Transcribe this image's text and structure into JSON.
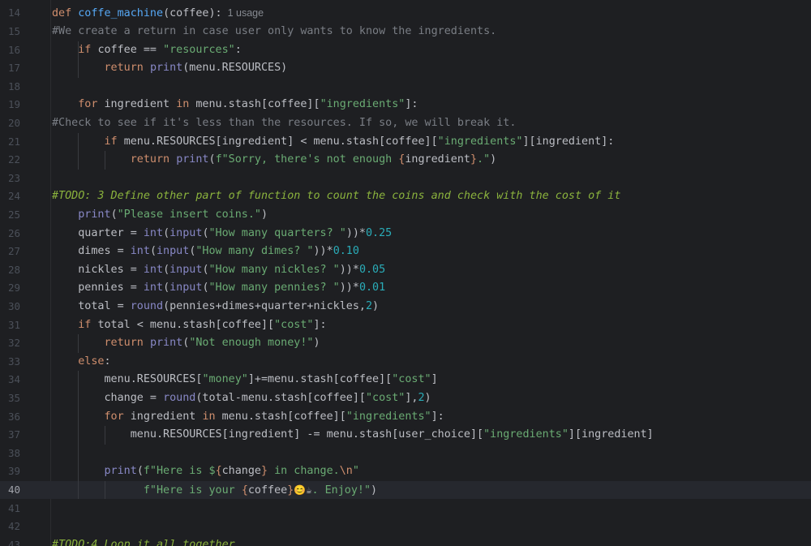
{
  "editor": {
    "current_line": "40",
    "usage_hint": "1 usage",
    "lines": [
      {
        "num": "14",
        "segs": [
          {
            "t": "def ",
            "c": "kw"
          },
          {
            "t": "coffe_machine",
            "c": "fn"
          },
          {
            "t": "(coffee):",
            "c": ""
          }
        ]
      },
      {
        "num": "15",
        "segs": [
          {
            "t": "#We create a return in case user only wants to know the ingredients.",
            "c": "cmt"
          }
        ]
      },
      {
        "num": "16",
        "segs": [
          {
            "t": "    ",
            "c": ""
          },
          {
            "t": "if ",
            "c": "kw"
          },
          {
            "t": "coffee == ",
            "c": ""
          },
          {
            "t": "\"resources\"",
            "c": "str"
          },
          {
            "t": ":",
            "c": ""
          }
        ]
      },
      {
        "num": "17",
        "segs": [
          {
            "t": "        ",
            "c": ""
          },
          {
            "t": "return ",
            "c": "kw"
          },
          {
            "t": "print",
            "c": "bi"
          },
          {
            "t": "(menu.RESOURCES)",
            "c": ""
          }
        ]
      },
      {
        "num": "18",
        "segs": []
      },
      {
        "num": "19",
        "segs": [
          {
            "t": "    ",
            "c": ""
          },
          {
            "t": "for ",
            "c": "kw"
          },
          {
            "t": "ingredient ",
            "c": ""
          },
          {
            "t": "in ",
            "c": "kw"
          },
          {
            "t": "menu.stash[coffee][",
            "c": ""
          },
          {
            "t": "\"ingredients\"",
            "c": "str"
          },
          {
            "t": "]:",
            "c": ""
          }
        ]
      },
      {
        "num": "20",
        "segs": [
          {
            "t": "#Check to see if it's less than the resources. If so, we will break it.",
            "c": "cmt"
          }
        ]
      },
      {
        "num": "21",
        "segs": [
          {
            "t": "        ",
            "c": ""
          },
          {
            "t": "if ",
            "c": "kw"
          },
          {
            "t": "menu.RESOURCES[ingredient] < menu.stash[coffee][",
            "c": ""
          },
          {
            "t": "\"ingredients\"",
            "c": "str"
          },
          {
            "t": "][ingredient]:",
            "c": ""
          }
        ]
      },
      {
        "num": "22",
        "segs": [
          {
            "t": "            ",
            "c": ""
          },
          {
            "t": "return ",
            "c": "kw"
          },
          {
            "t": "print",
            "c": "bi"
          },
          {
            "t": "(",
            "c": ""
          },
          {
            "t": "f\"Sorry, there's not enough ",
            "c": "str"
          },
          {
            "t": "{",
            "c": "brace"
          },
          {
            "t": "ingredient",
            "c": ""
          },
          {
            "t": "}",
            "c": "brace"
          },
          {
            "t": ".\"",
            "c": "str"
          },
          {
            "t": ")",
            "c": ""
          }
        ]
      },
      {
        "num": "23",
        "segs": []
      },
      {
        "num": "24",
        "segs": [
          {
            "t": "#TODO: 3 Define other part of function to count the coins and check with the cost of it",
            "c": "todo"
          }
        ]
      },
      {
        "num": "25",
        "segs": [
          {
            "t": "    ",
            "c": ""
          },
          {
            "t": "print",
            "c": "bi"
          },
          {
            "t": "(",
            "c": ""
          },
          {
            "t": "\"Please insert coins.\"",
            "c": "str"
          },
          {
            "t": ")",
            "c": ""
          }
        ]
      },
      {
        "num": "26",
        "segs": [
          {
            "t": "    quarter = ",
            "c": ""
          },
          {
            "t": "int",
            "c": "bi"
          },
          {
            "t": "(",
            "c": ""
          },
          {
            "t": "input",
            "c": "bi"
          },
          {
            "t": "(",
            "c": ""
          },
          {
            "t": "\"How many quarters? \"",
            "c": "str"
          },
          {
            "t": "))*",
            "c": ""
          },
          {
            "t": "0.25",
            "c": "num"
          }
        ]
      },
      {
        "num": "27",
        "segs": [
          {
            "t": "    dimes = ",
            "c": ""
          },
          {
            "t": "int",
            "c": "bi"
          },
          {
            "t": "(",
            "c": ""
          },
          {
            "t": "input",
            "c": "bi"
          },
          {
            "t": "(",
            "c": ""
          },
          {
            "t": "\"How many dimes? \"",
            "c": "str"
          },
          {
            "t": "))*",
            "c": ""
          },
          {
            "t": "0.10",
            "c": "num"
          }
        ]
      },
      {
        "num": "28",
        "segs": [
          {
            "t": "    nickles = ",
            "c": ""
          },
          {
            "t": "int",
            "c": "bi"
          },
          {
            "t": "(",
            "c": ""
          },
          {
            "t": "input",
            "c": "bi"
          },
          {
            "t": "(",
            "c": ""
          },
          {
            "t": "\"How many nickles? \"",
            "c": "str"
          },
          {
            "t": "))*",
            "c": ""
          },
          {
            "t": "0.05",
            "c": "num"
          }
        ]
      },
      {
        "num": "29",
        "segs": [
          {
            "t": "    pennies = ",
            "c": ""
          },
          {
            "t": "int",
            "c": "bi"
          },
          {
            "t": "(",
            "c": ""
          },
          {
            "t": "input",
            "c": "bi"
          },
          {
            "t": "(",
            "c": ""
          },
          {
            "t": "\"How many pennies? \"",
            "c": "str"
          },
          {
            "t": "))*",
            "c": ""
          },
          {
            "t": "0.01",
            "c": "num"
          }
        ]
      },
      {
        "num": "30",
        "segs": [
          {
            "t": "    total = ",
            "c": ""
          },
          {
            "t": "round",
            "c": "bi"
          },
          {
            "t": "(pennies+dimes+quarter+nickles,",
            "c": ""
          },
          {
            "t": "2",
            "c": "num"
          },
          {
            "t": ")",
            "c": ""
          }
        ]
      },
      {
        "num": "31",
        "segs": [
          {
            "t": "    ",
            "c": ""
          },
          {
            "t": "if ",
            "c": "kw"
          },
          {
            "t": "total < menu.stash[coffee][",
            "c": ""
          },
          {
            "t": "\"cost\"",
            "c": "str"
          },
          {
            "t": "]:",
            "c": ""
          }
        ]
      },
      {
        "num": "32",
        "segs": [
          {
            "t": "        ",
            "c": ""
          },
          {
            "t": "return ",
            "c": "kw"
          },
          {
            "t": "print",
            "c": "bi"
          },
          {
            "t": "(",
            "c": ""
          },
          {
            "t": "\"Not enough money!\"",
            "c": "str"
          },
          {
            "t": ")",
            "c": ""
          }
        ]
      },
      {
        "num": "33",
        "segs": [
          {
            "t": "    ",
            "c": ""
          },
          {
            "t": "else",
            "c": "kw"
          },
          {
            "t": ":",
            "c": ""
          }
        ]
      },
      {
        "num": "34",
        "segs": [
          {
            "t": "        menu.RESOURCES[",
            "c": ""
          },
          {
            "t": "\"money\"",
            "c": "str"
          },
          {
            "t": "]+=menu.stash[coffee][",
            "c": ""
          },
          {
            "t": "\"cost\"",
            "c": "str"
          },
          {
            "t": "]",
            "c": ""
          }
        ]
      },
      {
        "num": "35",
        "segs": [
          {
            "t": "        change = ",
            "c": ""
          },
          {
            "t": "round",
            "c": "bi"
          },
          {
            "t": "(total-menu.stash[coffee][",
            "c": ""
          },
          {
            "t": "\"cost\"",
            "c": "str"
          },
          {
            "t": "],",
            "c": ""
          },
          {
            "t": "2",
            "c": "num"
          },
          {
            "t": ")",
            "c": ""
          }
        ]
      },
      {
        "num": "36",
        "segs": [
          {
            "t": "        ",
            "c": ""
          },
          {
            "t": "for ",
            "c": "kw"
          },
          {
            "t": "ingredient ",
            "c": ""
          },
          {
            "t": "in ",
            "c": "kw"
          },
          {
            "t": "menu.stash[coffee][",
            "c": ""
          },
          {
            "t": "\"ingredients\"",
            "c": "str"
          },
          {
            "t": "]:",
            "c": ""
          }
        ]
      },
      {
        "num": "37",
        "segs": [
          {
            "t": "            menu.RESOURCES[ingredient] -= menu.stash[user_choice][",
            "c": ""
          },
          {
            "t": "\"ingredients\"",
            "c": "str"
          },
          {
            "t": "][ingredient]",
            "c": ""
          }
        ]
      },
      {
        "num": "38",
        "segs": []
      },
      {
        "num": "39",
        "segs": [
          {
            "t": "        ",
            "c": ""
          },
          {
            "t": "print",
            "c": "bi"
          },
          {
            "t": "(",
            "c": ""
          },
          {
            "t": "f\"Here is $",
            "c": "str"
          },
          {
            "t": "{",
            "c": "brace"
          },
          {
            "t": "change",
            "c": ""
          },
          {
            "t": "}",
            "c": "brace"
          },
          {
            "t": " in change.",
            "c": "str"
          },
          {
            "t": "\\n",
            "c": "esc"
          },
          {
            "t": "\"",
            "c": "str"
          }
        ]
      },
      {
        "num": "40",
        "segs": [
          {
            "t": "              ",
            "c": ""
          },
          {
            "t": "f\"Here is your ",
            "c": "str"
          },
          {
            "t": "{",
            "c": "brace"
          },
          {
            "t": "coffee",
            "c": ""
          },
          {
            "t": "}",
            "c": "brace"
          },
          {
            "t": "😊☕",
            "c": "emo"
          },
          {
            "t": ". Enjoy!\"",
            "c": "str"
          },
          {
            "t": ")",
            "c": ""
          }
        ]
      },
      {
        "num": "41",
        "segs": []
      },
      {
        "num": "42",
        "segs": []
      },
      {
        "num": "43",
        "segs": [
          {
            "t": "#TODO:4 Loop it all together",
            "c": "todo"
          }
        ]
      }
    ]
  }
}
